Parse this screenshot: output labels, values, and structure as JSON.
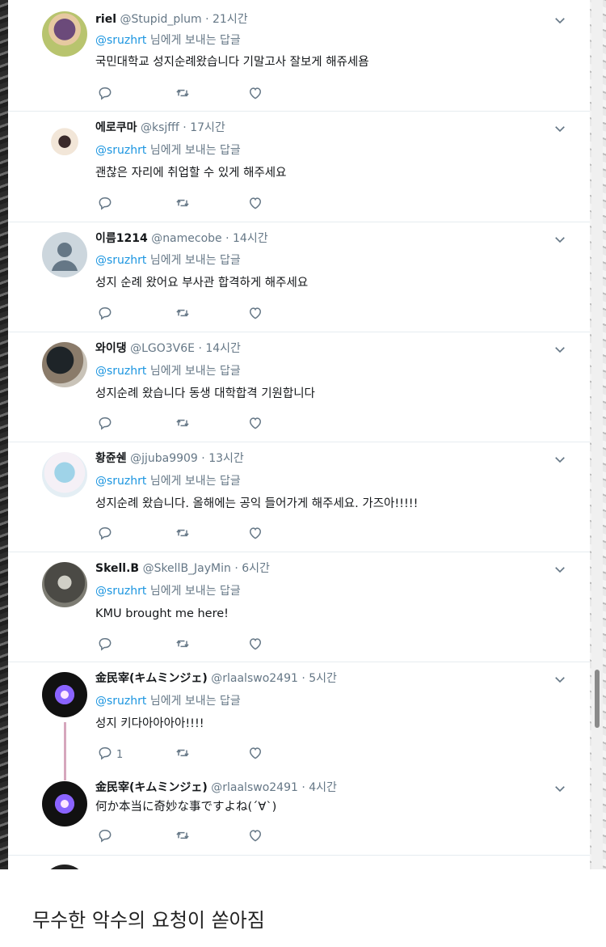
{
  "tweets": [
    {
      "name": "riel",
      "handle": "@Stupid_plum",
      "time": "21시간",
      "reply_mention": "@sruzhrt",
      "reply_suffix": " 님에게 보내는 답글",
      "text": "국민대학교 성지순례왔습니다 기말고사 잘보게 해쥬세욤",
      "reply_count": ""
    },
    {
      "name": "에로쿠마",
      "handle": "@ksjfff",
      "time": "17시간",
      "reply_mention": "@sruzhrt",
      "reply_suffix": " 님에게 보내는 답글",
      "text": "괜찮은 자리에 취업할 수 있게 해주세요",
      "reply_count": ""
    },
    {
      "name": "이름1214",
      "handle": "@namecobe",
      "time": "14시간",
      "reply_mention": "@sruzhrt",
      "reply_suffix": " 님에게 보내는 답글",
      "text": "성지 순례 왔어요 부사관 합격하게 해주세요",
      "reply_count": ""
    },
    {
      "name": "와이댕",
      "handle": "@LGO3V6E",
      "time": "14시간",
      "reply_mention": "@sruzhrt",
      "reply_suffix": " 님에게 보내는 답글",
      "text": "성지순례 왔습니다 동생 대학합격 기원합니다",
      "reply_count": ""
    },
    {
      "name": "황쥰쉔",
      "handle": "@jjuba9909",
      "time": "13시간",
      "reply_mention": "@sruzhrt",
      "reply_suffix": " 님에게 보내는 답글",
      "text": "성지순례 왔습니다. 올해에는 공익 들어가게 해주세요. 가즈아!!!!!",
      "reply_count": ""
    },
    {
      "name": "Skell.B",
      "handle": "@SkellB_JayMin",
      "time": "6시간",
      "reply_mention": "@sruzhrt",
      "reply_suffix": " 님에게 보내는 답글",
      "text": "KMU brought me here!",
      "reply_count": ""
    },
    {
      "name": "金民宰(キムミンジェ)",
      "handle": "@rlaalswo2491",
      "time": "5시간",
      "reply_mention": "@sruzhrt",
      "reply_suffix": " 님에게 보내는 답글",
      "text": "성지 키다아아아아!!!!",
      "reply_count": "1"
    },
    {
      "name": "金民宰(キムミンジェ)",
      "handle": "@rlaalswo2491",
      "time": "4시간",
      "reply_mention": "",
      "reply_suffix": "",
      "text": "何か本当に奇妙な事ですよね(´∀`)",
      "reply_count": ""
    }
  ],
  "separator": " · ",
  "caption": "무수한 악수의 요청이 쏟아짐",
  "colors": {
    "accent": "#1b95e0",
    "muted": "#657786",
    "thread_line": "#d6a7bd"
  },
  "icons": [
    "reply-icon",
    "retweet-icon",
    "like-icon",
    "caret-down-icon"
  ]
}
